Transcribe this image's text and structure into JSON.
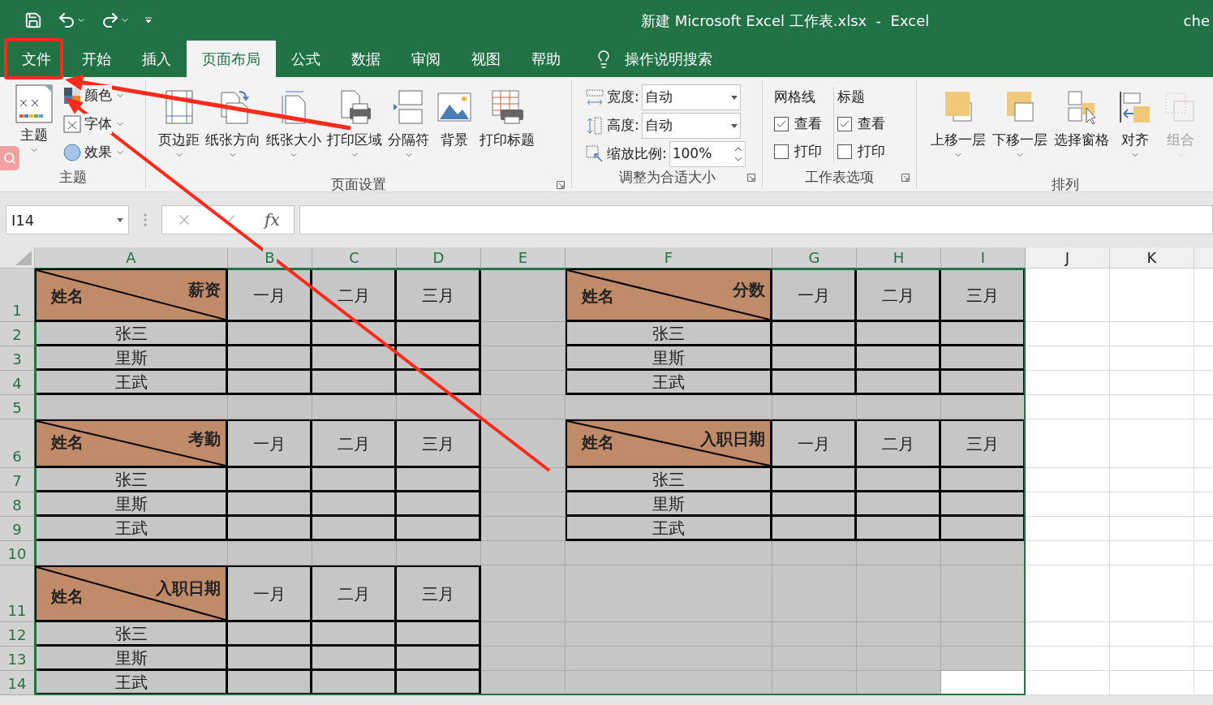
{
  "title_bar": {
    "title": "新建 Microsoft Excel 工作表.xlsx  -  Excel",
    "user": "che"
  },
  "tabs": [
    {
      "label": "文件",
      "selected": false
    },
    {
      "label": "开始",
      "selected": false
    },
    {
      "label": "插入",
      "selected": false
    },
    {
      "label": "页面布局",
      "selected": true
    },
    {
      "label": "公式",
      "selected": false
    },
    {
      "label": "数据",
      "selected": false
    },
    {
      "label": "审阅",
      "selected": false
    },
    {
      "label": "视图",
      "selected": false
    },
    {
      "label": "帮助",
      "selected": false
    }
  ],
  "tell_me": "操作说明搜索",
  "ribbon": {
    "themes": {
      "title": "主题",
      "main": "主题",
      "options": [
        "颜色",
        "字体",
        "效果"
      ]
    },
    "page_setup": {
      "title": "页面设置",
      "buttons": [
        {
          "label": "页边距",
          "menu": true
        },
        {
          "label": "纸张方向",
          "menu": true
        },
        {
          "label": "纸张大小",
          "menu": true
        },
        {
          "label": "打印区域",
          "menu": true
        },
        {
          "label": "分隔符",
          "menu": true
        },
        {
          "label": "背景",
          "menu": false
        },
        {
          "label": "打印标题",
          "menu": false
        }
      ]
    },
    "scale_to_fit": {
      "title": "调整为合适大小",
      "fields": [
        {
          "label": "宽度:",
          "value": "自动",
          "kind": "dropdown"
        },
        {
          "label": "高度:",
          "value": "自动",
          "kind": "dropdown"
        },
        {
          "label": "缩放比例:",
          "value": "100%",
          "kind": "spinner"
        }
      ]
    },
    "sheet_options": {
      "title": "工作表选项",
      "columns": [
        {
          "heading": "网格线",
          "options": [
            {
              "label": "查看",
              "checked": true
            },
            {
              "label": "打印",
              "checked": false
            }
          ]
        },
        {
          "heading": "标题",
          "options": [
            {
              "label": "查看",
              "checked": true
            },
            {
              "label": "打印",
              "checked": false
            }
          ]
        }
      ]
    },
    "arrange": {
      "title": "排列",
      "buttons": [
        {
          "label": "上移一层",
          "menu": true,
          "disabled": false
        },
        {
          "label": "下移一层",
          "menu": true,
          "disabled": false
        },
        {
          "label": "选择窗格",
          "menu": false,
          "disabled": false
        },
        {
          "label": "对齐",
          "menu": true,
          "disabled": false
        },
        {
          "label": "组合",
          "menu": true,
          "disabled": true
        }
      ]
    }
  },
  "formula_bar": {
    "name_box": "I14",
    "function_label": "fx"
  },
  "sheet": {
    "columns": [
      {
        "label": "A",
        "selected": true
      },
      {
        "label": "B",
        "selected": true
      },
      {
        "label": "C",
        "selected": true
      },
      {
        "label": "D",
        "selected": true
      },
      {
        "label": "E",
        "selected": true
      },
      {
        "label": "F",
        "selected": true
      },
      {
        "label": "G",
        "selected": true
      },
      {
        "label": "H",
        "selected": true
      },
      {
        "label": "I",
        "selected": true
      },
      {
        "label": "J",
        "selected": false
      },
      {
        "label": "K",
        "selected": false
      }
    ],
    "rows": [
      {
        "label": "1",
        "selected": true
      },
      {
        "label": "2",
        "selected": true
      },
      {
        "label": "3",
        "selected": true
      },
      {
        "label": "4",
        "selected": true
      },
      {
        "label": "5",
        "selected": true
      },
      {
        "label": "6",
        "selected": true
      },
      {
        "label": "7",
        "selected": true
      },
      {
        "label": "8",
        "selected": true
      },
      {
        "label": "9",
        "selected": true
      },
      {
        "label": "10",
        "selected": true
      },
      {
        "label": "11",
        "selected": true
      },
      {
        "label": "12",
        "selected": true
      },
      {
        "label": "13",
        "selected": true
      },
      {
        "label": "14",
        "selected": true
      }
    ],
    "tables": [
      {
        "header_left": "姓名",
        "header_right": "薪资",
        "months": [
          "一月",
          "二月",
          "三月"
        ],
        "names": [
          "张三",
          "里斯",
          "王武"
        ]
      },
      {
        "header_left": "姓名",
        "header_right": "分数",
        "months": [
          "一月",
          "二月",
          "三月"
        ],
        "names": [
          "张三",
          "里斯",
          "王武"
        ]
      },
      {
        "header_left": "姓名",
        "header_right": "考勤",
        "months": [
          "一月",
          "二月",
          "三月"
        ],
        "names": [
          "张三",
          "里斯",
          "王武"
        ]
      },
      {
        "header_left": "姓名",
        "header_right": "入职日期",
        "months": [
          "一月",
          "二月",
          "三月"
        ],
        "names": [
          "张三",
          "里斯",
          "王武"
        ]
      },
      {
        "header_left": "姓名",
        "header_right": "入职日期",
        "months": [
          "一月",
          "二月",
          "三月"
        ],
        "names": [
          "张三",
          "里斯",
          "王武"
        ]
      }
    ]
  }
}
